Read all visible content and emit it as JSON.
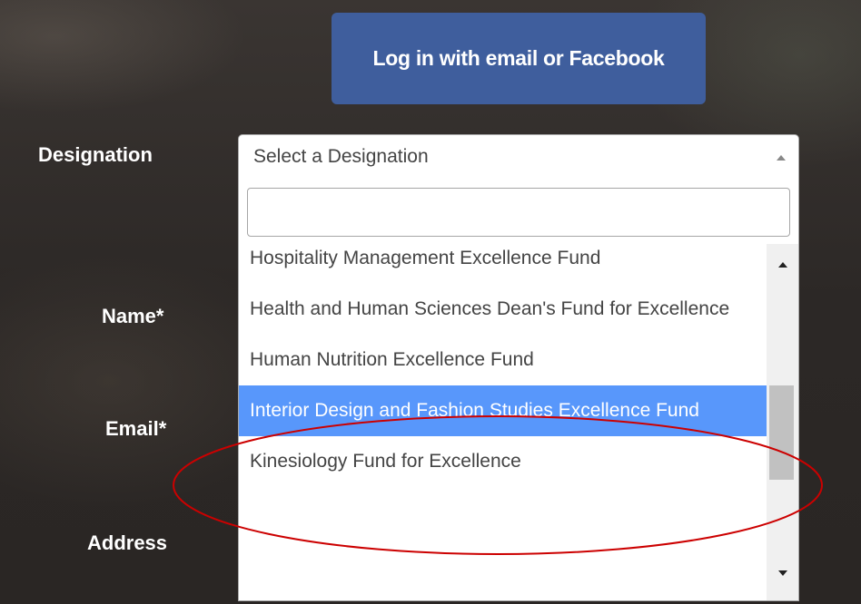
{
  "login": {
    "label": "Log in with email or Facebook"
  },
  "form": {
    "labels": {
      "designation": "Designation",
      "name": "Name*",
      "email": "Email*",
      "address": "Address"
    }
  },
  "designation_select": {
    "value": "Select a Designation",
    "search_value": "",
    "options": [
      "Hospitality Management Excellence Fund",
      "Health and Human Sciences Dean's Fund for Excellence",
      "Human Nutrition Excellence Fund",
      "Interior Design and Fashion Studies Excellence Fund",
      "Kinesiology Fund for Excellence"
    ],
    "selected_index": 3,
    "scroll": {
      "thumb_fraction": 0.33,
      "position_fraction": 0.55
    }
  },
  "colors": {
    "login_button": "#3f5e9d",
    "highlight": "#5897fb",
    "annotation": "#cc0000"
  },
  "icons": {
    "select_arrow": "triangle-up",
    "scroll_up": "triangle-up",
    "scroll_down": "triangle-down"
  }
}
